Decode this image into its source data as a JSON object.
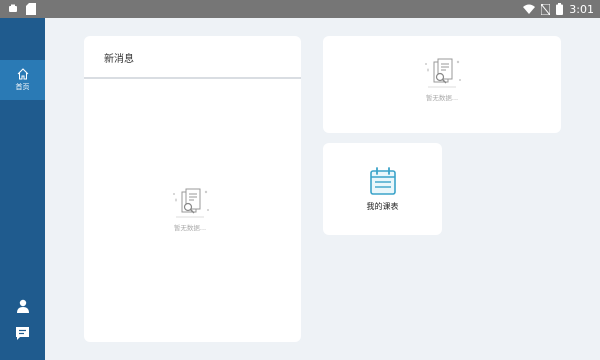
{
  "status_bar": {
    "time": "3:01",
    "icons": [
      "app-icon",
      "sd-card-icon",
      "wifi-icon",
      "no-sim-icon",
      "battery-icon"
    ]
  },
  "sidebar": {
    "home": {
      "label": "首页",
      "icon": "home-icon",
      "active_color": "#2a7ab5"
    },
    "bottom_icons": [
      "person-icon",
      "chat-icon"
    ],
    "bg_color": "#1f5b8e"
  },
  "messages_card": {
    "title": "新消息",
    "empty_text": "暂无数据..."
  },
  "top_right_card": {
    "empty_text": "暂无数据..."
  },
  "schedule_card": {
    "label": "我的课表",
    "icon": "calendar-icon",
    "icon_color": "#3ba3c9"
  }
}
